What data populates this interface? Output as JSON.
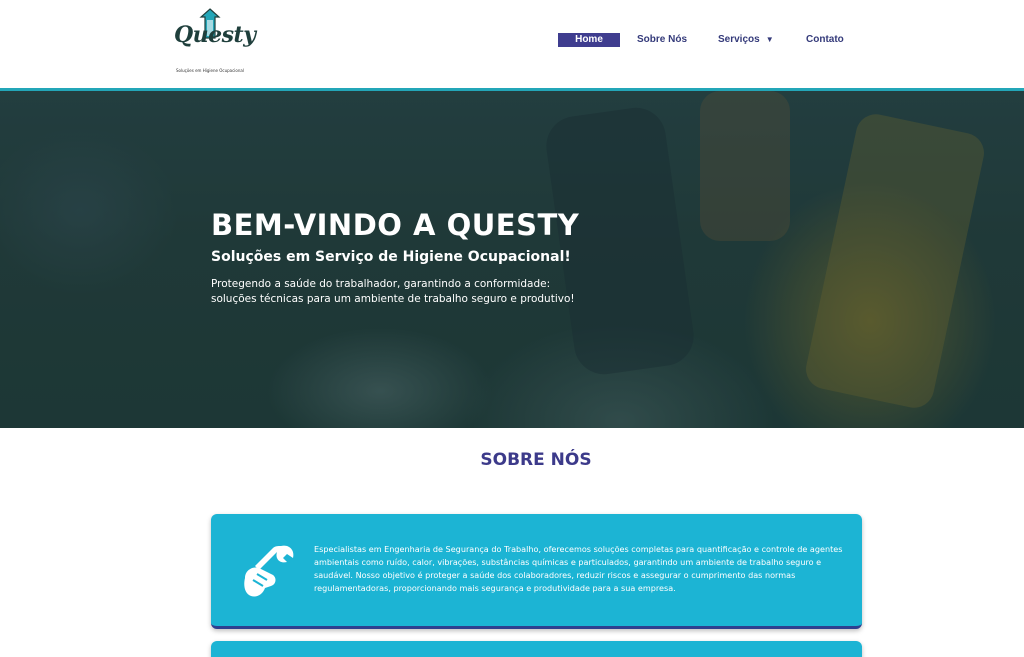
{
  "header": {
    "logo": {
      "wordmark": "Questy",
      "tagline": "Soluções em Higiene Ocupacional"
    },
    "nav": {
      "home": "Home",
      "sobre": "Sobre Nós",
      "servicos": "Serviços",
      "contato": "Contato"
    }
  },
  "hero": {
    "title": "BEM-VINDO A QUESTY",
    "subtitle": "Soluções em Serviço de Higiene Ocupacional!",
    "description": "Protegendo a saúde do trabalhador, garantindo a conformidade: soluções técnicas para um ambiente de trabalho seguro e produtivo!"
  },
  "about": {
    "title": "SOBRE NÓS",
    "card_text": "Especialistas em Engenharia de Segurança do Trabalho, oferecemos soluções completas para quantificação e controle de agentes ambientais como ruído, calor, vibrações, substâncias químicas e particulados, garantindo um ambiente de trabalho seguro e saudável. Nosso objetivo é proteger a saúde dos colaboradores, reduzir riscos e assegurar o cumprimento das normas regulamentadoras, proporcionando mais segurança e produtividade para a sua empresa."
  },
  "colors": {
    "accent_teal": "#1cb4d4",
    "brand_navy": "#3f3d8f",
    "header_line": "#23a6b8"
  },
  "icons": {
    "card_icon": "wrench-hand-icon",
    "servicos_caret": "caret-down-icon"
  }
}
